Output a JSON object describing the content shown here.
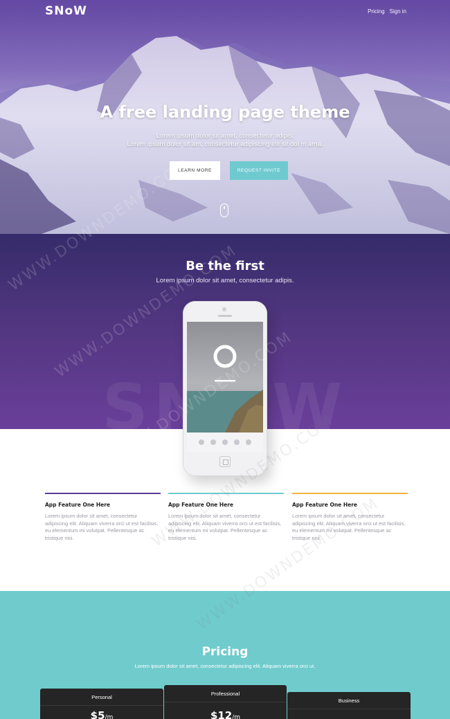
{
  "header": {
    "brand": "SNoW",
    "nav": [
      {
        "label": "Pricing"
      },
      {
        "label": "Sign in"
      }
    ]
  },
  "hero": {
    "title": "A free landing page theme",
    "subtitle_line1": "Lorem ipsum dolor sit amet, consectetur adipis.",
    "subtitle_line2": "Lorem ipsum dolor sit am, consectetur adipiscing elit sit dol m arna.",
    "learn_more": "LEARN MORE",
    "request_invite": "REQUEST INVITE"
  },
  "first": {
    "title": "Be the first",
    "subtitle": "Lorem ipsum dolor sit amet, consectetur adipis.",
    "background_wordmark": "SNOW"
  },
  "features": [
    {
      "title": "App Feature One Here",
      "text": "Lorem ipsum dolor sit amet, consectetur adipiscing elit. Aliquam viverra orci ut est facilisis, eu elementum mi volutpat. Pellentesque ac tristique nisi.",
      "accent": "#5a3b9a"
    },
    {
      "title": "App Feature One Here",
      "text": "Lorem ipsum dolor sit amet, consectetur adipiscing elit. Aliquam viverra orci ut est facilisis, eu elementum mi volutpat. Pellentesque ac tristique nisi.",
      "accent": "#6fcad0"
    },
    {
      "title": "App Feature One Here",
      "text": "Lorem ipsum dolor sit amet, consectetur adipiscing elit. Aliquam viverra orci ut est facilisis, eu elementum mi volutpat. Pellentesque ac tristique nisi.",
      "accent": "#f0b43c"
    }
  ],
  "pricing": {
    "title": "Pricing",
    "subtitle": "Lorem ipsum dolor sit amet, consectetur adipiscing elit. Aliquam viverra orci ut.",
    "plans": [
      {
        "name": "Personal",
        "price": "$5",
        "period": "/m"
      },
      {
        "name": "Professional",
        "price": "$12",
        "period": "/m"
      },
      {
        "name": "Business",
        "price": "",
        "period": ""
      }
    ]
  },
  "watermark": "WWW.DOWNDEMO.COM",
  "colors": {
    "hero_purple": "#6a4fa6",
    "section_purple": "#51367f",
    "teal": "#70cbcd",
    "invite_button": "#6fcad0",
    "plan_card": "#252525"
  }
}
